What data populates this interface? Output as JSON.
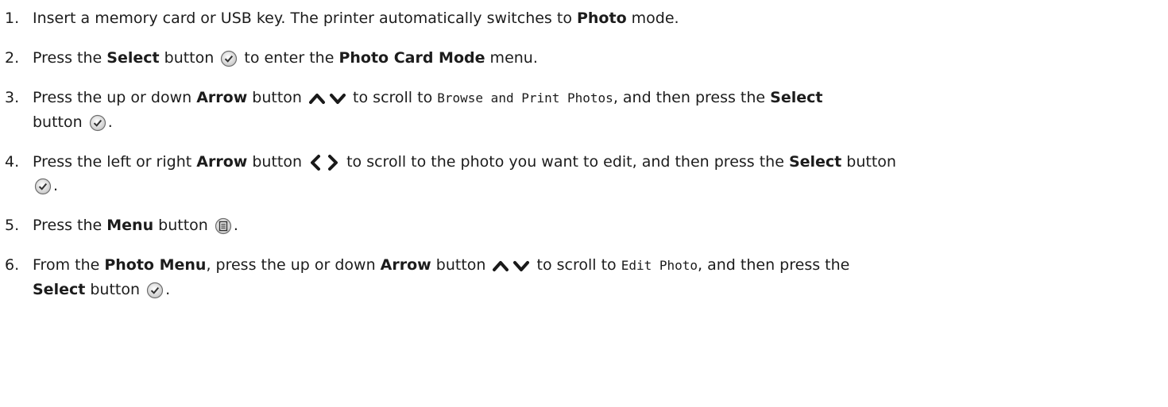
{
  "steps": [
    {
      "num": "1.",
      "t1": "Insert a memory card or USB key. The printer automatically switches to ",
      "b1": "Photo",
      "t2": " mode."
    },
    {
      "num": "2.",
      "t1": "Press the ",
      "b1": "Select",
      "t2": " button ",
      "t3": " to enter the ",
      "b2": "Photo Card Mode",
      "t4": " menu."
    },
    {
      "num": "3.",
      "t1": "Press the up or down ",
      "b1": "Arrow",
      "t2": " button ",
      "t3": " to scroll to ",
      "code1": "Browse and Print Photos",
      "t4": ", and then press the ",
      "b2": "Select",
      "t5": " button ",
      "t6": "."
    },
    {
      "num": "4.",
      "t1": "Press the left or right ",
      "b1": "Arrow",
      "t2": " button ",
      "t3": " to scroll to the photo you want to edit, and then press the ",
      "b2": "Select",
      "t4": " button ",
      "t5": "."
    },
    {
      "num": "5.",
      "t1": "Press the ",
      "b1": "Menu",
      "t2": " button ",
      "t3": "."
    },
    {
      "num": "6.",
      "t1": "From the ",
      "b1": "Photo Menu",
      "t2": ", press the up or down ",
      "b2": "Arrow",
      "t3": " button ",
      "t4": " to scroll to ",
      "code1": "Edit Photo",
      "t5": ", and then press the ",
      "b3": "Select",
      "t6": " button ",
      "t7": "."
    }
  ],
  "icons": {
    "select": "select-check-icon",
    "up_down": "up-down-arrow-icon",
    "left_right": "left-right-arrow-icon",
    "menu": "menu-icon"
  }
}
